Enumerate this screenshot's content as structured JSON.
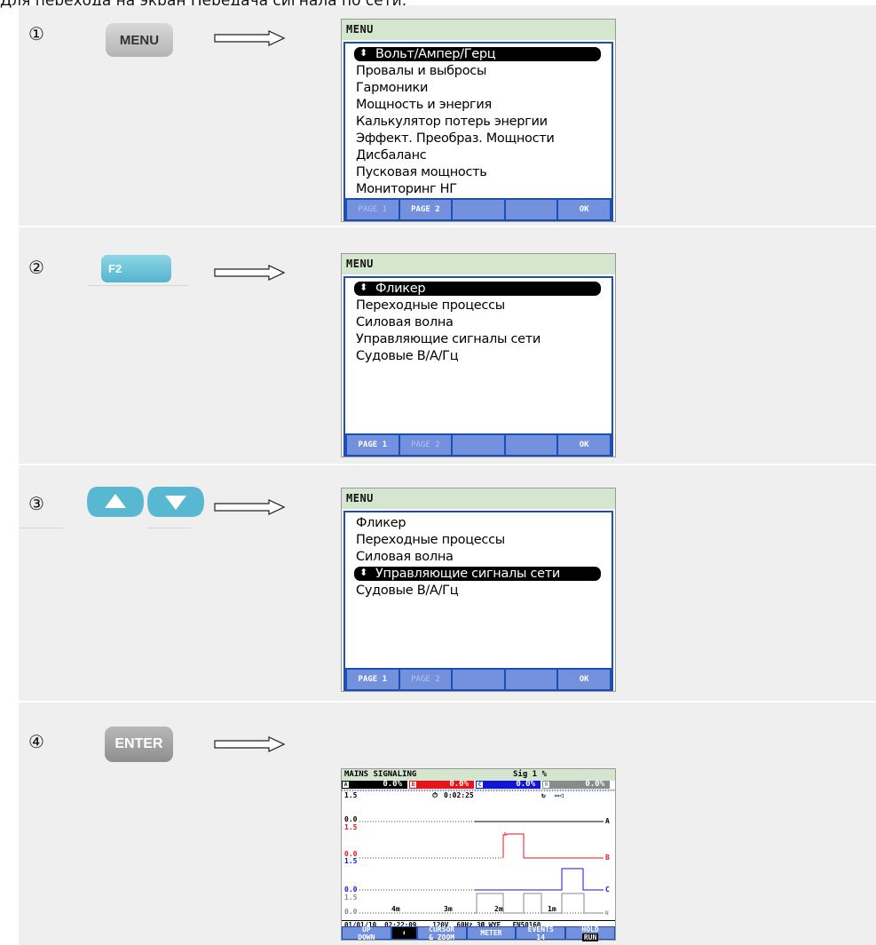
{
  "intro": "Для перехода на экран Передача сигнала по сети:",
  "steps": [
    {
      "num": "①",
      "key": "MENU"
    },
    {
      "num": "②",
      "key": "F2"
    },
    {
      "num": "③",
      "key_up": "▲",
      "key_down": "▼"
    },
    {
      "num": "④",
      "key": "ENTER"
    }
  ],
  "screen1": {
    "title": "MENU",
    "selected_marker": "⬍",
    "items": [
      "Вольт/Ампер/Герц",
      "Провалы и выбросы",
      "Гармоники",
      "Мощность и энергия",
      "Калькулятор потерь энергии",
      "Эффект. Преобраз. Мощности",
      "Дисбаланс",
      "Пусковая мощность",
      "Мониторинг НГ"
    ],
    "fkeys": [
      "PAGE 1",
      "PAGE 2",
      "",
      "",
      "OK"
    ]
  },
  "screen2": {
    "title": "MENU",
    "items": [
      "Фликер",
      "Переходные процессы",
      "Силовая волна",
      "Управляющие сигналы сети",
      "Судовые В/А/Гц"
    ],
    "fkeys": [
      "PAGE 1",
      "PAGE 2",
      "",
      "",
      "OK"
    ]
  },
  "screen3": {
    "title": "MENU",
    "items": [
      "Фликер",
      "Переходные процессы",
      "Силовая волна",
      "Управляющие сигналы сети",
      "Судовые В/А/Гц"
    ],
    "fkeys": [
      "PAGE 1",
      "PAGE 2",
      "",
      "",
      "OK"
    ]
  },
  "screen4": {
    "title": "MAINS SIGNALING",
    "sig": "Sig 1 %",
    "phases": [
      {
        "tag": "A",
        "value": "0.0%",
        "color": "#000000"
      },
      {
        "tag": "B",
        "value": "0.0%",
        "color": "#e8141b"
      },
      {
        "tag": "C",
        "value": "0.0%",
        "color": "#1414d6"
      },
      {
        "tag": "N",
        "value": "0.0%",
        "color": "#8a8a8a"
      }
    ],
    "scale_top": "1.5",
    "elapsed": "0:02:25",
    "trace_labels": [
      "0.0",
      "1.5",
      "0.0",
      "1.5",
      "0.0",
      "1.5",
      "0.0"
    ],
    "trace_names": [
      "A",
      "B",
      "C",
      "N"
    ],
    "time_ticks": [
      "4m",
      "3m",
      "2m",
      "1m"
    ],
    "status": "01/01/10  02:22:09    120V  60Hz 3Ø WYE   EN50160",
    "fkeys": [
      "UP\nDOWN",
      "⬍",
      "CURSOR\n& ZOOM",
      "METER",
      "EVENTS\n14",
      "HOLD"
    ],
    "run_label": "RUN"
  }
}
